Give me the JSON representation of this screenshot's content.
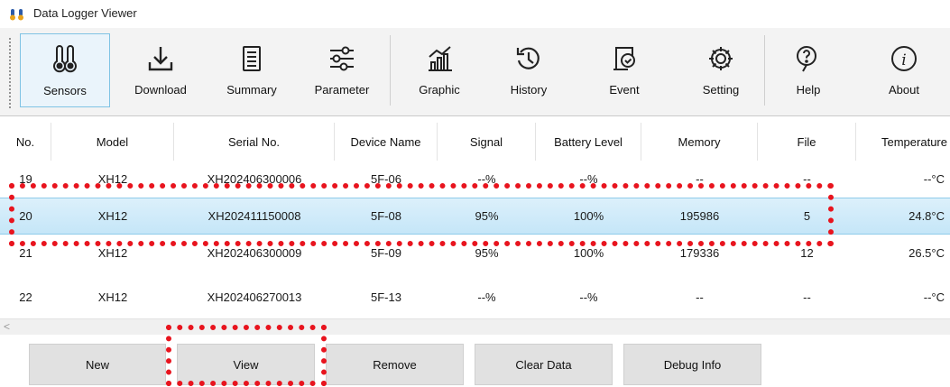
{
  "window": {
    "title": "Data Logger Viewer",
    "app_icon": "thermometer-icon"
  },
  "toolbar": {
    "items": [
      {
        "label": "Sensors",
        "icon": "thermometer-icon",
        "active": true
      },
      {
        "label": "Download",
        "icon": "download-icon"
      },
      {
        "label": "Summary",
        "icon": "document-list-icon"
      },
      {
        "label": "Parameter",
        "icon": "sliders-icon"
      },
      {
        "label": "Graphic",
        "icon": "chart-icon"
      },
      {
        "label": "History",
        "icon": "history-icon"
      },
      {
        "label": "Event",
        "icon": "event-check-icon"
      },
      {
        "label": "Setting",
        "icon": "gear-icon"
      },
      {
        "label": "Help",
        "icon": "help-icon"
      },
      {
        "label": "About",
        "icon": "info-icon"
      }
    ]
  },
  "table": {
    "columns": [
      "No.",
      "Model",
      "Serial No.",
      "Device Name",
      "Signal",
      "Battery Level",
      "Memory",
      "File",
      "Temperature"
    ],
    "rows": [
      [
        "19",
        "XH12",
        "XH202406300006",
        "5F-06",
        "--%",
        "--%",
        "--",
        "--",
        "--°C"
      ],
      [
        "20",
        "XH12",
        "XH202411150008",
        "5F-08",
        "95%",
        "100%",
        "195986",
        "5",
        "24.8°C"
      ],
      [
        "21",
        "XH12",
        "XH202406300009",
        "5F-09",
        "95%",
        "100%",
        "179336",
        "12",
        "26.5°C"
      ],
      [
        "22",
        "XH12",
        "XH202406270013",
        "5F-13",
        "--%",
        "--%",
        "--",
        "--",
        "--°C"
      ]
    ],
    "selected_row": 1
  },
  "buttons": {
    "new": "New",
    "view": "View",
    "remove": "Remove",
    "clear_data": "Clear Data",
    "debug_info": "Debug Info"
  },
  "colors": {
    "highlight": "#e8141e",
    "selection": "#c5e6f8",
    "active_border": "#7fc3e4"
  }
}
